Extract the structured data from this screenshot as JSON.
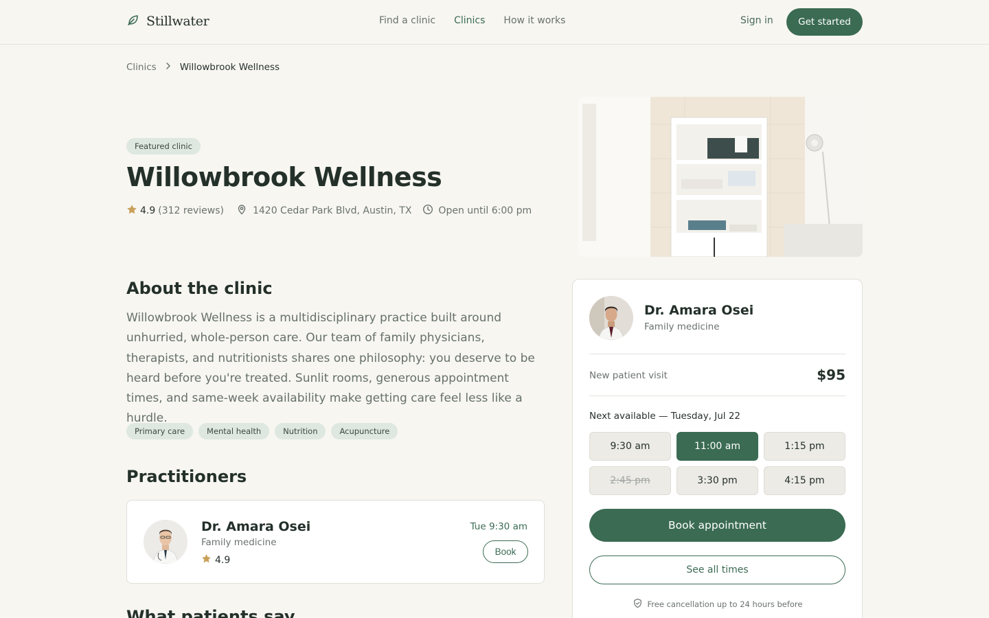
{
  "nav": {
    "brand": "Stillwater",
    "links": [
      "Find a clinic",
      "Clinics",
      "How it works"
    ],
    "active_link": "Clinics",
    "sign_in": "Sign in",
    "cta": "Get started"
  },
  "breadcrumb": {
    "parent": "Clinics",
    "current": "Willowbrook Wellness"
  },
  "clinic": {
    "badge": "Featured clinic",
    "name": "Willowbrook Wellness",
    "rating": "4.9",
    "reviews": "(312 reviews)",
    "address": "1420 Cedar Park Blvd, Austin, TX",
    "hours": "Open until 6:00 pm"
  },
  "about": {
    "heading": "About the clinic",
    "body": "Willowbrook Wellness is a multidisciplinary practice built around unhurried, whole-person care. Our team of family physicians, therapists, and nutritionists shares one philosophy: you deserve to be heard before you're treated. Sunlit rooms, generous appointment times, and same-week availability make getting care feel less like a hurdle.",
    "tags": [
      "Primary care",
      "Mental health",
      "Nutrition",
      "Acupuncture"
    ]
  },
  "practitioners": {
    "heading": "Practitioners",
    "items": [
      {
        "name": "Dr. Amara Osei",
        "specialty": "Family medicine",
        "rating": "4.9",
        "next": "Tue 9:30 am",
        "book": "Book"
      }
    ]
  },
  "next_section": {
    "heading": "What patients say"
  },
  "booking": {
    "name": "Dr. Amara Osei",
    "specialty": "Family medicine",
    "visit_label": "New patient visit",
    "price": "$95",
    "next_available": "Next available — Tuesday, Jul 22",
    "slots": [
      {
        "time": "9:30 am",
        "state": "available"
      },
      {
        "time": "11:00 am",
        "state": "selected"
      },
      {
        "time": "1:15 pm",
        "state": "available"
      },
      {
        "time": "2:45 pm",
        "state": "unavailable"
      },
      {
        "time": "3:30 pm",
        "state": "available"
      },
      {
        "time": "4:15 pm",
        "state": "available"
      }
    ],
    "book_button": "Book appointment",
    "see_all": "See all times",
    "cancellation": "Free cancellation up to 24 hours before"
  },
  "colors": {
    "accent": "#3b6b53",
    "star": "#c9a15a",
    "background": "#f7f6f1"
  },
  "icons": [
    "leaf-icon",
    "chevron-right-icon",
    "star-icon",
    "map-pin-icon",
    "clock-icon",
    "shield-check-icon"
  ]
}
